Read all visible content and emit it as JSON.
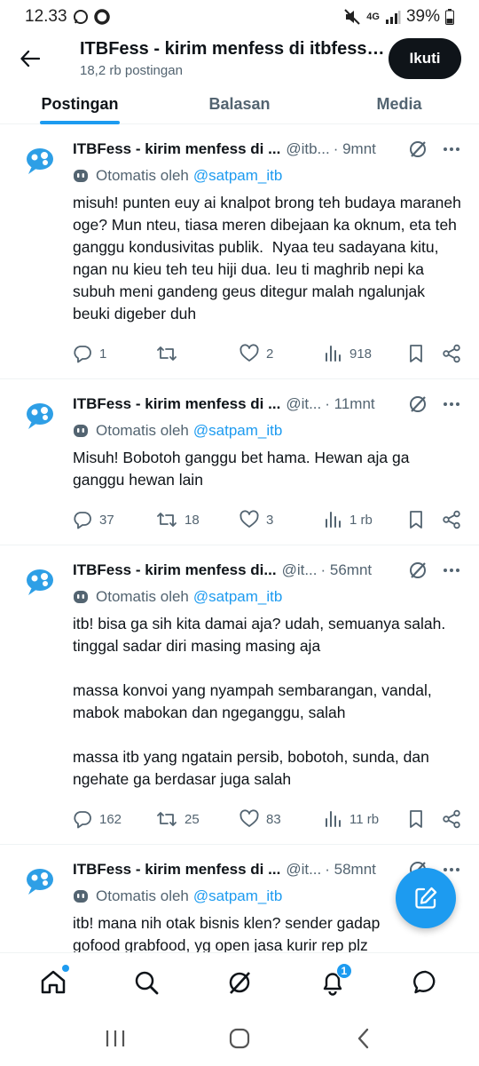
{
  "status_bar": {
    "time": "12.33",
    "network": "4G",
    "battery": "39%"
  },
  "header": {
    "title": "ITBFess - kirim menfess di itbfess.com",
    "post_count": "18,2 rb postingan",
    "follow_label": "Ikuti"
  },
  "tabs": [
    {
      "label": "Postingan"
    },
    {
      "label": "Balasan"
    },
    {
      "label": "Media"
    }
  ],
  "posts": [
    {
      "name": "ITBFess - kirim menfess di ...",
      "handle": "@itb...",
      "time": "· 9mnt",
      "auto_prefix": "Otomatis oleh",
      "auto_link": "@satpam_itb",
      "text": "misuh! punten euy ai knalpot brong teh budaya maraneh oge? Mun nteu, tiasa meren dibejaan ka oknum, eta teh ganggu kondusivitas publik.  Nyaa teu sadayana kitu, ngan nu kieu teh teu hiji dua. Ieu ti maghrib nepi ka subuh meni gandeng geus ditegur malah ngalunjak beuki digeber duh",
      "replies": "1",
      "reposts": "",
      "likes": "2",
      "views": "918"
    },
    {
      "name": "ITBFess - kirim menfess di ...",
      "handle": "@it...",
      "time": "· 11mnt",
      "auto_prefix": "Otomatis oleh",
      "auto_link": "@satpam_itb",
      "text": "Misuh! Bobotoh ganggu bet hama. Hewan aja ga ganggu hewan lain",
      "replies": "37",
      "reposts": "18",
      "likes": "3",
      "views": "1 rb"
    },
    {
      "name": "ITBFess - kirim menfess di...",
      "handle": "@it...",
      "time": "· 56mnt",
      "auto_prefix": "Otomatis oleh",
      "auto_link": "@satpam_itb",
      "text": "itb! bisa ga sih kita damai aja? udah, semuanya salah. tinggal sadar diri masing masing aja\n\nmassa konvoi yang nyampah sembarangan, vandal, mabok mabokan dan ngeganggu, salah\n\nmassa itb yang ngatain persib, bobotoh, sunda, dan ngehate ga berdasar juga salah",
      "replies": "162",
      "reposts": "25",
      "likes": "83",
      "views": "11 rb"
    },
    {
      "name": "ITBFess - kirim menfess di ...",
      "handle": "@it...",
      "time": "· 58mnt",
      "auto_prefix": "Otomatis oleh",
      "auto_link": "@satpam_itb",
      "text": "itb! mana nih otak bisnis klen? sender gadap\ngofood grabfood, yg open jasa kurir rep plz",
      "replies": "",
      "reposts": "",
      "likes": "",
      "views": ""
    }
  ],
  "bottom_nav": {
    "notifications_badge": "1"
  },
  "colors": {
    "accent": "#1d9bf0",
    "text_primary": "#0f1419",
    "text_secondary": "#536471",
    "divider": "#eff3f4"
  },
  "icons": [
    "back-arrow-icon",
    "bot-icon",
    "grok-icon",
    "more-icon",
    "reply-icon",
    "repost-icon",
    "like-icon",
    "views-icon",
    "bookmark-icon",
    "share-icon",
    "compose-icon",
    "home-icon",
    "search-icon",
    "bell-icon",
    "messages-icon"
  ]
}
